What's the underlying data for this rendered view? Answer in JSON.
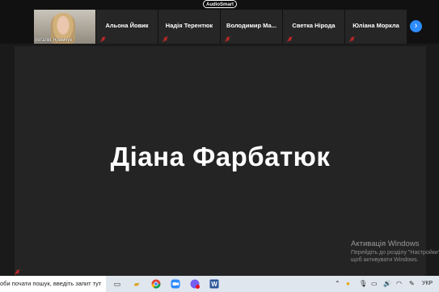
{
  "top_bar": {
    "brand": "AudioSmart"
  },
  "participants": [
    {
      "name": "Віталія Яремчук",
      "video": true
    },
    {
      "name": "Альона Йовик"
    },
    {
      "name": "Надія Терентюк"
    },
    {
      "name": "Володимир Ма..."
    },
    {
      "name": "Светка Нірода"
    },
    {
      "name": "Юліана Моркла"
    }
  ],
  "next_page_glyph": "›",
  "active_speaker": {
    "name": "Діана Фарбатюк"
  },
  "windows_activation": {
    "title": "Активація Windows",
    "subtitle": "Перейдіть до розділу \"Настройки\", щоб активувати Windows."
  },
  "taskbar": {
    "search_placeholder": "оби почати пошук, введіть запит тут",
    "language": "УКР",
    "accent_color": "#2d8cff"
  }
}
